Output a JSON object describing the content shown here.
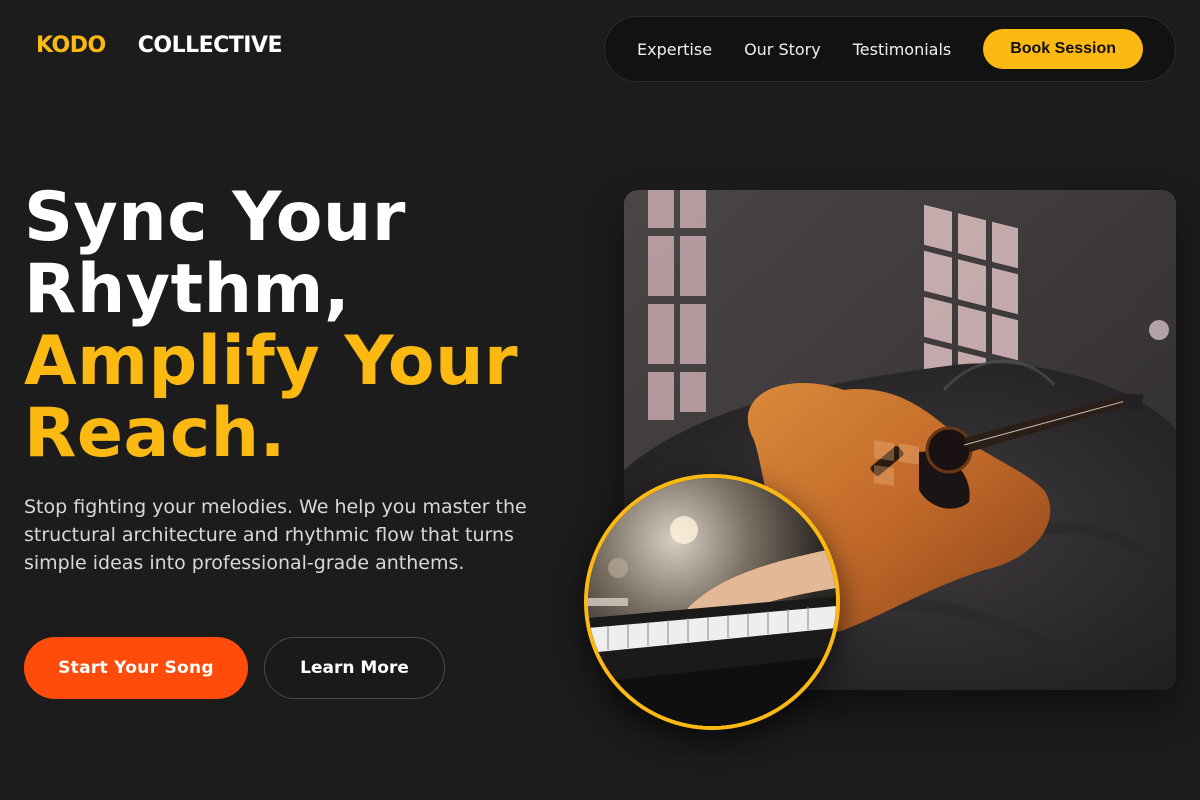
{
  "brand": {
    "part1": "KODO",
    "part2": "COLLECTIVE",
    "accent_color": "#fcb912"
  },
  "nav": {
    "links": [
      "Expertise",
      "Our Story",
      "Testimonials"
    ],
    "cta": "Book Session"
  },
  "hero": {
    "headline_line1": "Sync Your",
    "headline_line2": "Rhythm,",
    "headline_line3": "Amplify Your",
    "headline_line4": "Reach.",
    "subtitle": "Stop fighting your melodies. We help you master the structural architecture and rhythmic flow that turns simple ideas into professional-grade anthems.",
    "primary_button": "Start Your Song",
    "secondary_button": "Learn More",
    "primary_color": "#ff4c0a"
  },
  "images": {
    "main_photo": "acoustic-guitar-on-bean-bag-photo",
    "round_photo": "hands-playing-keyboard-photo"
  }
}
